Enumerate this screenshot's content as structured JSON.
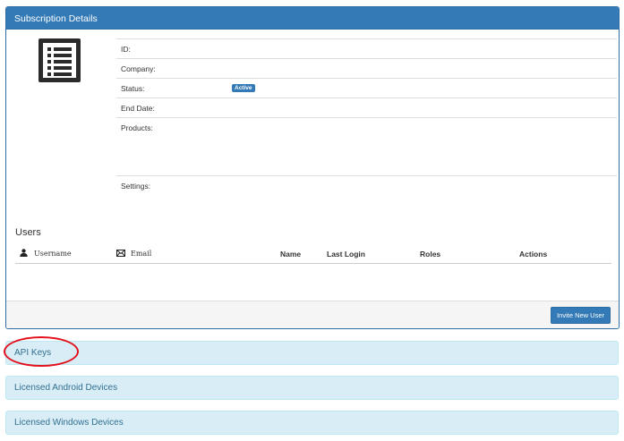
{
  "subscription": {
    "heading": "Subscription Details",
    "icon": "document-list-icon",
    "fields": {
      "id_label": "ID:",
      "company_label": "Company:",
      "status_label": "Status:",
      "status_badge": "Active",
      "end_date_label": "End Date:",
      "products_label": "Products:",
      "settings_label": "Settings:"
    },
    "colors": {
      "primary": "#337ab7",
      "info_bg": "#d9edf7",
      "info_text": "#31708f",
      "annotation": "#e3101c"
    }
  },
  "users": {
    "title": "Users",
    "columns": {
      "username": "Username",
      "email": "Email",
      "name": "Name",
      "last_login": "Last Login",
      "roles": "Roles",
      "actions": "Actions"
    },
    "invite_button": "Invite New User"
  },
  "panels": {
    "api_keys": "API Keys",
    "android_devices": "Licensed Android Devices",
    "windows_devices": "Licensed Windows Devices"
  }
}
